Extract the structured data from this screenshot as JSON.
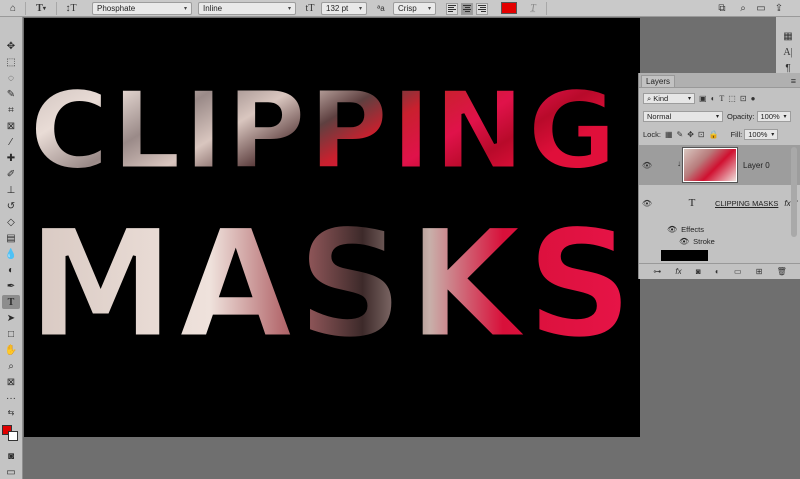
{
  "options_bar": {
    "home_icon": "home-icon",
    "tool_icon": "type-tool-icon",
    "orientation_icon": "text-orientation-icon",
    "font_family": "Phosphate",
    "font_style": "Inline",
    "font_size_icon": "font-size-icon",
    "font_size": "132 pt",
    "antialias_icon": "antialias-icon",
    "antialias": "Crisp",
    "align_left": "align-left",
    "align_center": "align-center",
    "align_right": "align-right",
    "text_color": "#e30000",
    "warp_icon": "warp-text-icon",
    "right_icons": [
      "panel-icon",
      "search-icon",
      "workspace-icon",
      "share-icon"
    ]
  },
  "canvas": {
    "line1": "CLIPPING",
    "line2": "MASKS"
  },
  "layers_panel": {
    "tab": "Layers",
    "filter_label": "Kind",
    "blend_mode": "Normal",
    "opacity_label": "Opacity:",
    "opacity": "100%",
    "lock_label": "Lock:",
    "fill_label": "Fill:",
    "fill": "100%",
    "layers": [
      {
        "name": "Layer 0",
        "type": "image",
        "selected": true
      },
      {
        "name": "CLIPPING MASKS",
        "type": "text",
        "fx": "fx"
      }
    ],
    "effects_label": "Effects",
    "stroke_label": "Stroke"
  },
  "colors": {
    "foreground": "#e00000",
    "background": "#ffffff",
    "accent_red": "#d8103a"
  }
}
